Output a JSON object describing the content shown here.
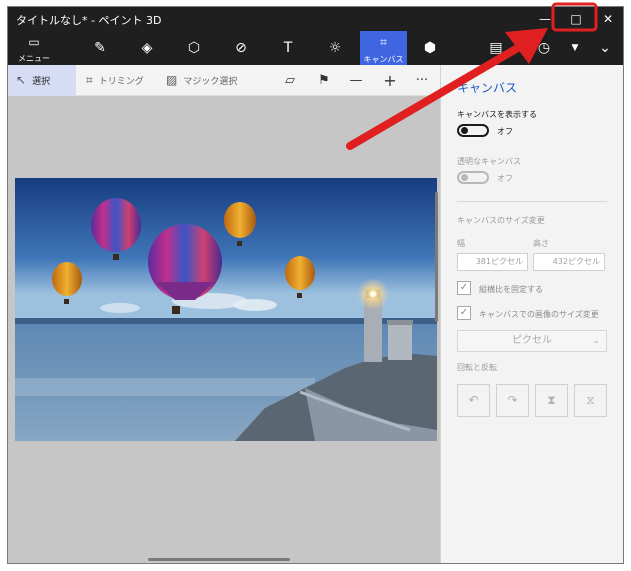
{
  "window": {
    "title": "タイトルなし* - ペイント 3D",
    "min_glyph": "—",
    "max_glyph": "□",
    "close_glyph": "✕"
  },
  "toolbar": {
    "menu_label": "メニュー",
    "canvas_label": "キャンバス",
    "text_glyph": "T"
  },
  "subtoolbar": {
    "select_label": "選択",
    "trim_label": "トリミング",
    "magic_label": "マジック選択",
    "minus_glyph": "—",
    "plus_glyph": "+",
    "more_glyph": "···"
  },
  "panel": {
    "title": "キャンバス",
    "show_canvas_label": "キャンバスを表示する",
    "show_canvas_state": "オフ",
    "transparent_label": "透明なキャンバス",
    "transparent_state": "オフ",
    "size_label": "キャンバスのサイズ変更",
    "width_label": "幅",
    "height_label": "高さ",
    "width_value": "381ピクセル",
    "height_value": "432ピクセル",
    "lock_aspect_label": "縦横比を固定する",
    "resize_image_label": "キャンバスでの画像のサイズ変更",
    "unit_value": "ピクセル",
    "rotate_label": "回転と反転"
  },
  "colors": {
    "accent": "#3f66e0",
    "titlebar": "#1f1f1f",
    "highlight": "#e02020"
  }
}
